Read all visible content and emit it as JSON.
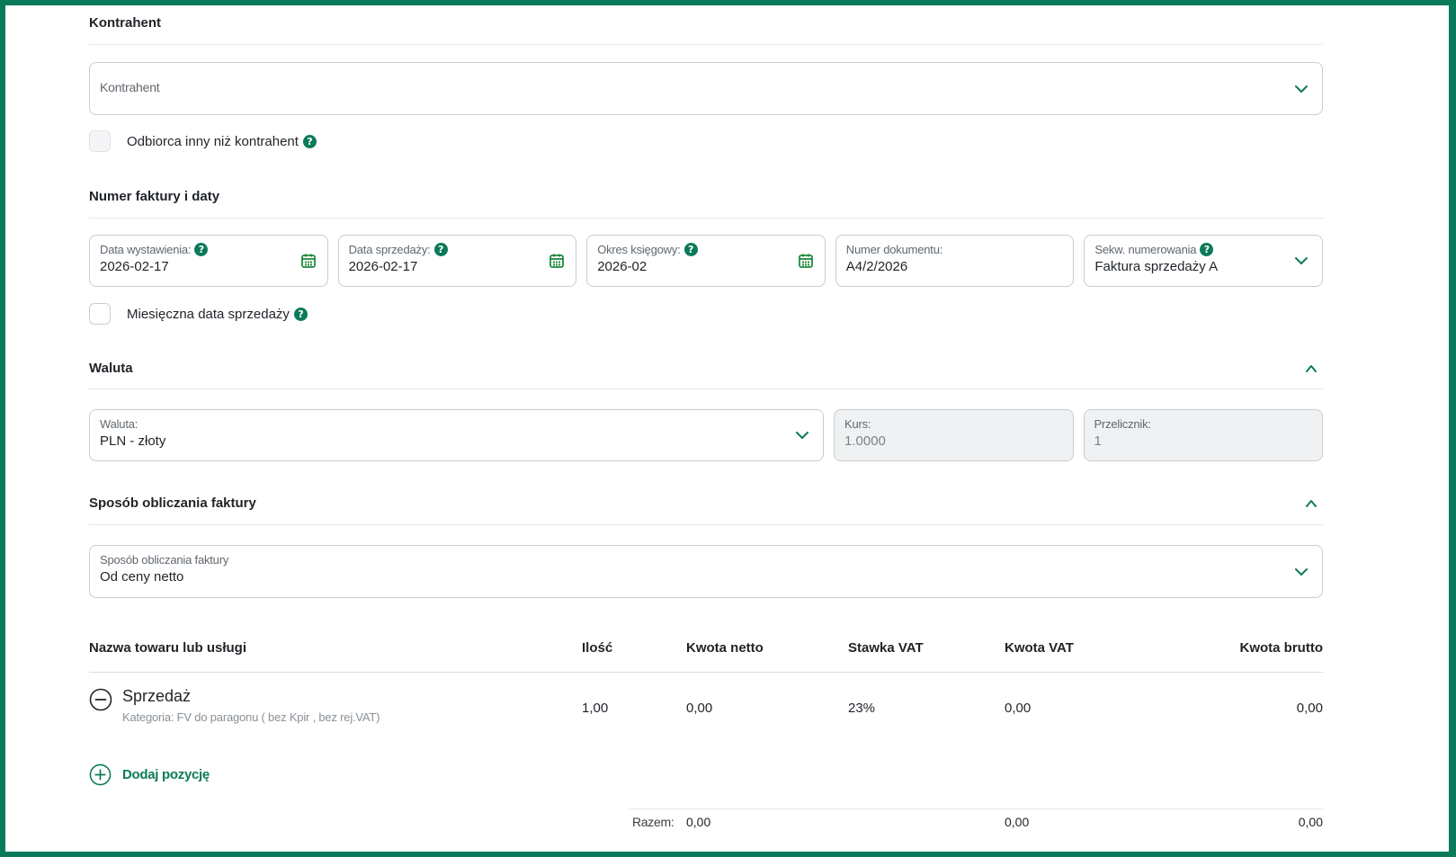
{
  "contractor": {
    "section_title": "Kontrahent",
    "field_placeholder": "Kontrahent",
    "other_recipient_label": "Odbiorca inny niż kontrahent"
  },
  "invoice_dates": {
    "section_title": "Numer faktury i daty",
    "issue_date": {
      "label": "Data wystawienia:",
      "value": "2026-02-17"
    },
    "sale_date": {
      "label": "Data sprzedaży:",
      "value": "2026-02-17"
    },
    "accounting_period": {
      "label": "Okres księgowy:",
      "value": "2026-02"
    },
    "document_number": {
      "label": "Numer dokumentu:",
      "value": "A4/2/2026"
    },
    "numbering_sequence": {
      "label": "Sekw. numerowania",
      "value": "Faktura sprzedaży A"
    },
    "monthly_sale_date_label": "Miesięczna data sprzedaży"
  },
  "currency": {
    "section_title": "Waluta",
    "currency_field": {
      "label": "Waluta:",
      "value": "PLN - złoty"
    },
    "rate_field": {
      "label": "Kurs:",
      "value": "1.0000"
    },
    "converter_field": {
      "label": "Przelicznik:",
      "value": "1"
    }
  },
  "calculation": {
    "section_title": "Sposób obliczania faktury",
    "field": {
      "label": "Sposób obliczania faktury",
      "value": "Od ceny netto"
    }
  },
  "items_table": {
    "headers": {
      "name": "Nazwa towaru lub usługi",
      "qty": "Ilość",
      "net": "Kwota netto",
      "vat_rate": "Stawka VAT",
      "vat": "Kwota VAT",
      "gross": "Kwota brutto"
    },
    "rows": [
      {
        "name": "Sprzedaż",
        "category": "Kategoria: FV do paragonu ( bez Kpir , bez rej.VAT)",
        "qty": "1,00",
        "net": "0,00",
        "vat_rate": "23%",
        "vat": "0,00",
        "gross": "0,00"
      }
    ],
    "add_item_label": "Dodaj pozycję",
    "totals": {
      "label": "Razem:",
      "net": "0,00",
      "vat": "0,00",
      "gross": "0,00"
    }
  },
  "help_glyph": "?",
  "colors": {
    "accent": "#0b7a5a",
    "border": "#c7cdd2",
    "disabled_bg": "#f0f1f2"
  }
}
